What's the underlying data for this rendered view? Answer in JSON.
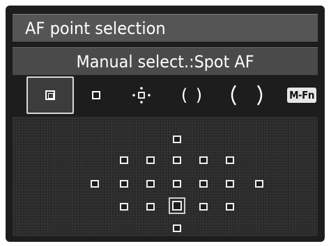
{
  "menu": {
    "title": "AF point selection",
    "mode_label": "Manual select.:Spot AF"
  },
  "af_modes": [
    {
      "icon": "spot-af-icon",
      "selected": true
    },
    {
      "icon": "single-point-af-icon",
      "selected": false
    },
    {
      "icon": "af-point-expansion-icon",
      "selected": false
    },
    {
      "icon": "zone-af-icon",
      "selected": false
    },
    {
      "icon": "auto-select-af-icon",
      "selected": false
    },
    {
      "icon": "m-fn-button-icon",
      "label": "M-Fn",
      "selected": false
    }
  ],
  "af_points": {
    "rows": [
      1,
      5,
      7,
      5,
      1
    ],
    "selected": "center"
  },
  "colors": {
    "background": "#1d1d1d",
    "bar": "#555555",
    "text": "#ffffff"
  }
}
